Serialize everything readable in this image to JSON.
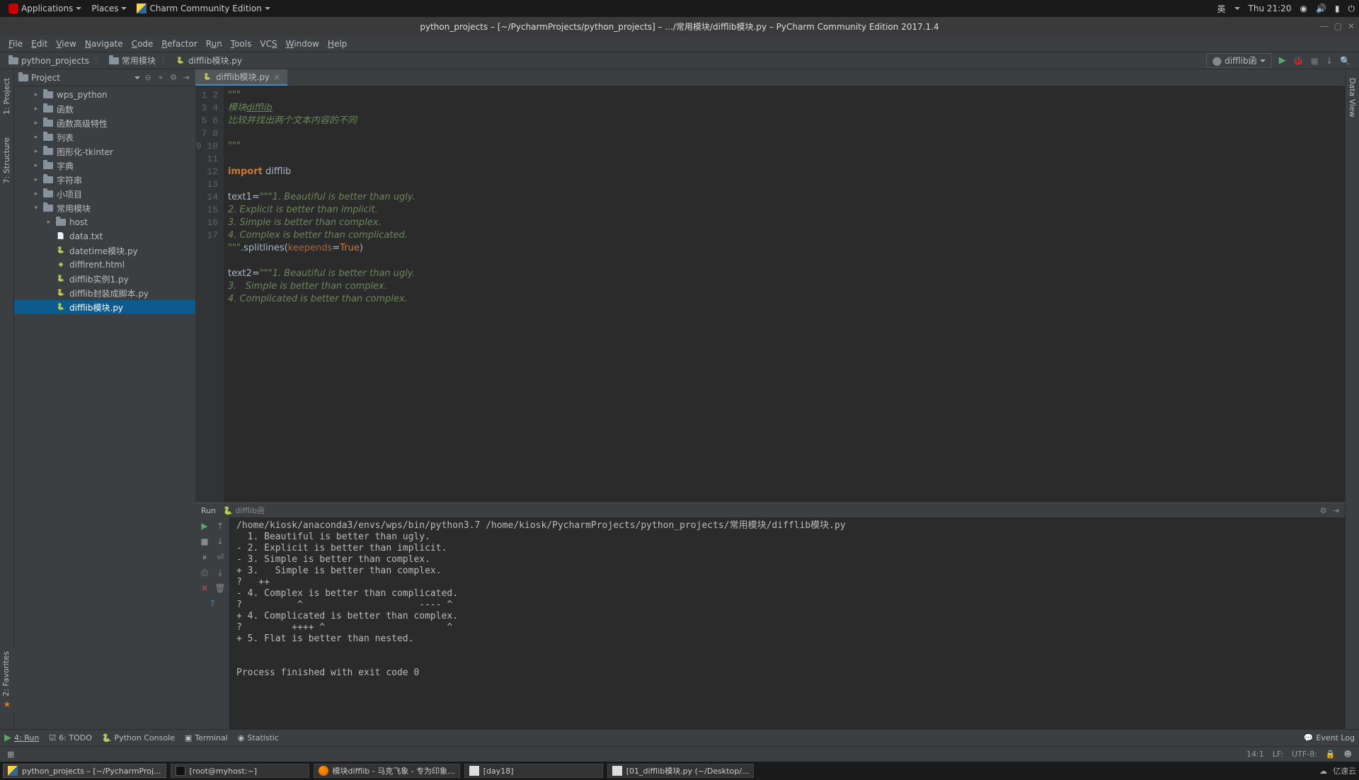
{
  "sysbar": {
    "apps": "Applications",
    "places": "Places",
    "appname": "Charm Community Edition",
    "ime": "英",
    "clock": "Thu 21:20"
  },
  "window": {
    "title": "python_projects – [~/PycharmProjects/python_projects] – .../常用模块/difflib模块.py – PyCharm Community Edition 2017.1.4"
  },
  "menus": [
    "File",
    "Edit",
    "View",
    "Navigate",
    "Code",
    "Refactor",
    "Run",
    "Tools",
    "VCS",
    "Window",
    "Help"
  ],
  "breadcrumb": {
    "root": "python_projects",
    "mid": "常用模块",
    "file": "difflib模块.py"
  },
  "runconfig": "difflib函",
  "sidebar": {
    "title": "Project",
    "tree": [
      {
        "l": 1,
        "t": "d",
        "arrow": "▸",
        "label": "wps_python"
      },
      {
        "l": 1,
        "t": "d",
        "arrow": "▸",
        "label": "函数"
      },
      {
        "l": 1,
        "t": "d",
        "arrow": "▸",
        "label": "函数高级特性"
      },
      {
        "l": 1,
        "t": "d",
        "arrow": "▸",
        "label": "列表"
      },
      {
        "l": 1,
        "t": "d",
        "arrow": "▸",
        "label": "图形化-tkinter"
      },
      {
        "l": 1,
        "t": "d",
        "arrow": "▸",
        "label": "字典"
      },
      {
        "l": 1,
        "t": "d",
        "arrow": "▸",
        "label": "字符串"
      },
      {
        "l": 1,
        "t": "d",
        "arrow": "▸",
        "label": "小项目"
      },
      {
        "l": 1,
        "t": "d",
        "arrow": "▾",
        "label": "常用模块"
      },
      {
        "l": 2,
        "t": "d",
        "arrow": "▸",
        "label": "host"
      },
      {
        "l": 2,
        "t": "f",
        "arrow": "",
        "label": "data.txt"
      },
      {
        "l": 2,
        "t": "p",
        "arrow": "",
        "label": "datetime模块.py"
      },
      {
        "l": 2,
        "t": "h",
        "arrow": "",
        "label": "diffirent.html"
      },
      {
        "l": 2,
        "t": "p",
        "arrow": "",
        "label": "difflib实例1.py"
      },
      {
        "l": 2,
        "t": "p",
        "arrow": "",
        "label": "difflib封装成脚本.py"
      },
      {
        "l": 2,
        "t": "p",
        "arrow": "",
        "label": "difflib模块.py",
        "sel": true
      }
    ]
  },
  "tab": {
    "label": "difflib模块.py"
  },
  "code": {
    "lines": [
      "1",
      "2",
      "3",
      "4",
      "5",
      "6",
      "7",
      "8",
      "9",
      "10",
      "11",
      "12",
      "13",
      "14",
      "15",
      "16",
      "17"
    ],
    "l1": "\"\"\"",
    "l2a": "模块",
    "l2b": "difflib",
    "l3": "比较并找出两个文本内容的不同",
    "l5": "\"\"\"",
    "l7a": "import",
    "l7b": " difflib",
    "l9a": "text1=",
    "l9b": "\"\"\"1. Beautiful is better than ugly.",
    "l10": "2. Explicit is better than implicit.",
    "l11": "3. Simple is better than complex.",
    "l12": "4. Complex is better than complicated.",
    "l13a": "\"\"\"",
    "l13b": ".splitlines(",
    "l13c": "keepends",
    "l13d": "=",
    "l13e": "True",
    "l13f": ")",
    "l15a": "text2=",
    "l15b": "\"\"\"1. Beautiful is better than ugly.",
    "l16": "3.   Simple is better than complex.",
    "l17": "4. Complicated is better than complex."
  },
  "run": {
    "title": "Run",
    "cfg": "difflib函",
    "out": "/home/kiosk/anaconda3/envs/wps/bin/python3.7 /home/kiosk/PycharmProjects/python_projects/常用模块/difflib模块.py\n  1. Beautiful is better than ugly.\n- 2. Explicit is better than implicit.\n- 3. Simple is better than complex.\n+ 3.   Simple is better than complex.\n?   ++\n- 4. Complex is better than complicated.\n?          ^                     ---- ^\n+ 4. Complicated is better than complex.\n?         ++++ ^                      ^\n+ 5. Flat is better than nested.\n\n\nProcess finished with exit code 0"
  },
  "bottomtabs": {
    "run": "4: Run",
    "todo": "6: TODO",
    "pyconsole": "Python Console",
    "terminal": "Terminal",
    "statistic": "Statistic",
    "eventlog": "Event Log"
  },
  "status": {
    "pos": "14:1",
    "lf": "LF:",
    "enc": "UTF-8:"
  },
  "taskbar": {
    "t1": "python_projects – [~/PycharmProj...",
    "t2": "[root@myhost:~]",
    "t3": "模块difflib - 马克飞象 - 专为印象...",
    "t4": "[day18]",
    "t5": "[01_difflib模块.py (~/Desktop/...",
    "tray": "亿速云"
  },
  "leftside": {
    "project": "1: Project",
    "structure": "7: Structure",
    "favorites": "2: Favorites"
  },
  "rightside": {
    "dataview": "Data View"
  }
}
